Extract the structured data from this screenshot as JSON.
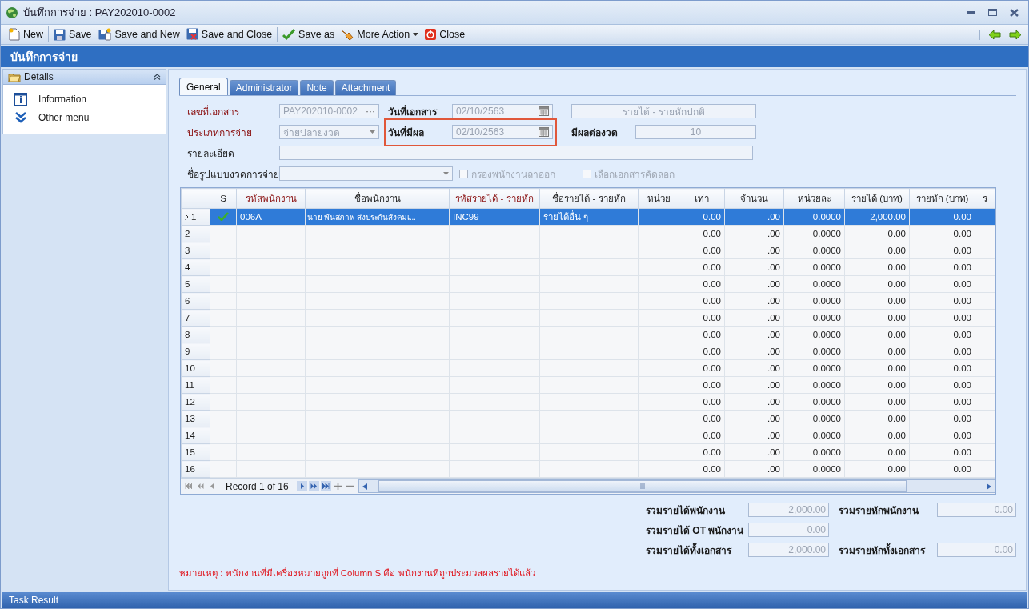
{
  "window": {
    "title": "บันทึกการจ่าย : PAY202010-0002"
  },
  "toolbar": {
    "groups": [
      [
        {
          "label": "New",
          "kind": "new",
          "dropdown": false
        }
      ],
      [
        {
          "label": "Save",
          "kind": "save",
          "dropdown": false
        },
        {
          "label": "Save and New",
          "kind": "save_new",
          "dropdown": false
        },
        {
          "label": "Save and Close",
          "kind": "save_close",
          "dropdown": false
        }
      ],
      [
        {
          "label": "Save as",
          "kind": "save_as",
          "dropdown": false
        },
        {
          "label": "More Action",
          "kind": "more",
          "dropdown": true
        },
        {
          "label": "Close",
          "kind": "close",
          "dropdown": false
        }
      ]
    ]
  },
  "header": {
    "title": "บันทึกการจ่าย"
  },
  "sidebar": {
    "title": "Details",
    "items": [
      {
        "label": "Information",
        "kind": "info"
      },
      {
        "label": "Other menu",
        "kind": "more"
      }
    ]
  },
  "tabs": [
    {
      "label": "General",
      "selected": true
    },
    {
      "label": "Administrator",
      "selected": false
    },
    {
      "label": "Note",
      "selected": false
    },
    {
      "label": "Attachment",
      "selected": false
    }
  ],
  "form": {
    "doc_no": {
      "label": "เลขที่เอกสาร",
      "required": true,
      "value": "PAY202010-0002",
      "button": "···"
    },
    "doc_date": {
      "label": "วันที่เอกสาร",
      "required": false,
      "value": "02/10/2563"
    },
    "doc_type": {
      "value": "รายได้ - รายหักปกติ"
    },
    "pay_type": {
      "label": "ประเภทการจ่าย",
      "required": true,
      "value": "จ่ายปลายงวด"
    },
    "effective_date": {
      "label": "วันที่มีผล",
      "required": false,
      "value": "02/10/2563",
      "highlighted": true
    },
    "period": {
      "label": "มีผลต่องวด",
      "required": false,
      "value": "10"
    },
    "description": {
      "label": "รายละเอียด",
      "required": false
    },
    "period_template": {
      "label": "ชื่อรูปแบบงวดการจ่าย",
      "required": false
    },
    "checkboxes": [
      {
        "label": "กรองพนักงานลาออก",
        "checked": false
      },
      {
        "label": "เลือกเอกสารคัดลอก",
        "checked": false
      }
    ]
  },
  "grid": {
    "columns": [
      {
        "label": "S",
        "required": false
      },
      {
        "label": "รหัสพนักงาน",
        "required": true
      },
      {
        "label": "ชื่อพนักงาน",
        "required": false
      },
      {
        "label": "รหัสรายได้ - รายหัก",
        "required": true
      },
      {
        "label": "ชื่อรายได้ - รายหัก",
        "required": false
      },
      {
        "label": "หน่วย",
        "required": false
      },
      {
        "label": "เท่า",
        "required": false
      },
      {
        "label": "จำนวน",
        "required": false
      },
      {
        "label": "หน่วยละ",
        "required": false
      },
      {
        "label": "รายได้ (บาท)",
        "required": false
      },
      {
        "label": "รายหัก (บาท)",
        "required": false
      },
      {
        "label": "ร",
        "required": false
      }
    ],
    "rows": [
      {
        "num": "1",
        "selected": true,
        "s_checked": true,
        "employee_code": "006A",
        "employee_name": "นาย พันสภาพ ส่งประกันสังคมเ...",
        "item_code": "INC99",
        "item_name": "รายได้อื่น ๆ",
        "amounts": [
          "0.00",
          ".00",
          "0.0000",
          "2,000.00",
          "0.00"
        ]
      },
      {
        "num": "2",
        "selected": false,
        "s_checked": false,
        "amounts": [
          "0.00",
          ".00",
          "0.0000",
          "0.00",
          "0.00"
        ]
      },
      {
        "num": "3",
        "selected": false,
        "s_checked": false,
        "amounts": [
          "0.00",
          ".00",
          "0.0000",
          "0.00",
          "0.00"
        ]
      },
      {
        "num": "4",
        "selected": false,
        "s_checked": false,
        "amounts": [
          "0.00",
          ".00",
          "0.0000",
          "0.00",
          "0.00"
        ]
      },
      {
        "num": "5",
        "selected": false,
        "s_checked": false,
        "amounts": [
          "0.00",
          ".00",
          "0.0000",
          "0.00",
          "0.00"
        ]
      },
      {
        "num": "6",
        "selected": false,
        "s_checked": false,
        "amounts": [
          "0.00",
          ".00",
          "0.0000",
          "0.00",
          "0.00"
        ]
      },
      {
        "num": "7",
        "selected": false,
        "s_checked": false,
        "amounts": [
          "0.00",
          ".00",
          "0.0000",
          "0.00",
          "0.00"
        ]
      },
      {
        "num": "8",
        "selected": false,
        "s_checked": false,
        "amounts": [
          "0.00",
          ".00",
          "0.0000",
          "0.00",
          "0.00"
        ]
      },
      {
        "num": "9",
        "selected": false,
        "s_checked": false,
        "amounts": [
          "0.00",
          ".00",
          "0.0000",
          "0.00",
          "0.00"
        ]
      },
      {
        "num": "10",
        "selected": false,
        "s_checked": false,
        "amounts": [
          "0.00",
          ".00",
          "0.0000",
          "0.00",
          "0.00"
        ]
      },
      {
        "num": "11",
        "selected": false,
        "s_checked": false,
        "amounts": [
          "0.00",
          ".00",
          "0.0000",
          "0.00",
          "0.00"
        ]
      },
      {
        "num": "12",
        "selected": false,
        "s_checked": false,
        "amounts": [
          "0.00",
          ".00",
          "0.0000",
          "0.00",
          "0.00"
        ]
      },
      {
        "num": "13",
        "selected": false,
        "s_checked": false,
        "amounts": [
          "0.00",
          ".00",
          "0.0000",
          "0.00",
          "0.00"
        ]
      },
      {
        "num": "14",
        "selected": false,
        "s_checked": false,
        "amounts": [
          "0.00",
          ".00",
          "0.0000",
          "0.00",
          "0.00"
        ]
      },
      {
        "num": "15",
        "selected": false,
        "s_checked": false,
        "amounts": [
          "0.00",
          ".00",
          "0.0000",
          "0.00",
          "0.00"
        ]
      },
      {
        "num": "16",
        "selected": false,
        "s_checked": false,
        "amounts": [
          "0.00",
          ".00",
          "0.0000",
          "0.00",
          "0.00"
        ]
      }
    ],
    "pager": "Record 1 of 16"
  },
  "totals": [
    [
      {
        "label": "รวมรายได้พนักงาน",
        "value": "2,000.00"
      },
      {
        "label": "รวมรายหักพนักงาน",
        "value": "0.00"
      }
    ],
    [
      {
        "label": "รวมรายได้ OT พนักงาน",
        "value": "0.00"
      }
    ],
    [
      {
        "label": "รวมรายได้ทั้งเอกสาร",
        "value": "2,000.00"
      },
      {
        "label": "รวมรายหักทั้งเอกสาร",
        "value": "0.00"
      }
    ]
  ],
  "note": "หมายเหตุ : พนักงานที่มีเครื่องหมายถูกที่ Column S คือ พนักงานที่ถูกประมวลผลรายได้แล้ว",
  "status_bar": {
    "title": "Task Result"
  }
}
